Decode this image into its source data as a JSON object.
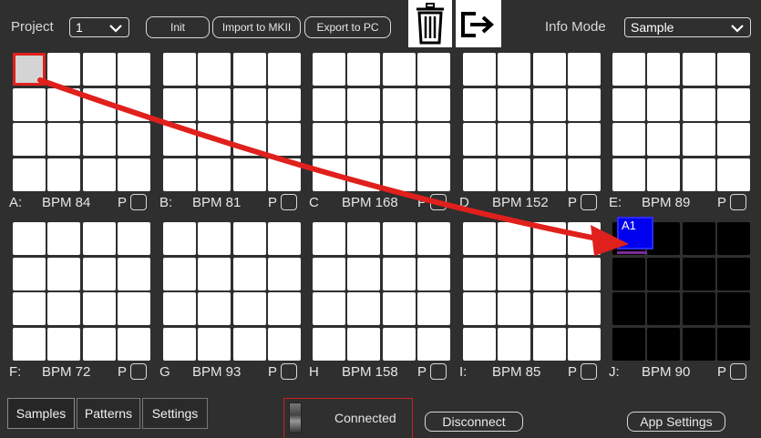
{
  "toolbar": {
    "project_label": "Project",
    "project_value": "1",
    "init_label": "Init",
    "import_label": "Import to MKII",
    "export_label": "Export to PC",
    "info_mode_label": "Info Mode",
    "info_mode_value": "Sample"
  },
  "banks": {
    "A": {
      "letter": "A:",
      "bpm": "BPM 84",
      "p": "P"
    },
    "B": {
      "letter": "B:",
      "bpm": "BPM 81",
      "p": "P"
    },
    "C": {
      "letter": "C",
      "bpm": "BPM 168",
      "p": "P"
    },
    "D": {
      "letter": "D",
      "bpm": "BPM 152",
      "p": "P"
    },
    "E": {
      "letter": "E:",
      "bpm": "BPM 89",
      "p": "P"
    },
    "F": {
      "letter": "F:",
      "bpm": "BPM 72",
      "p": "P"
    },
    "G": {
      "letter": "G",
      "bpm": "BPM 93",
      "p": "P"
    },
    "H": {
      "letter": "H",
      "bpm": "BPM 158",
      "p": "P"
    },
    "I": {
      "letter": "I:",
      "bpm": "BPM 85",
      "p": "P"
    },
    "J": {
      "letter": "J:",
      "bpm": "BPM 90",
      "p": "P"
    }
  },
  "drop_marker": {
    "label": "A1"
  },
  "tabs": {
    "samples": "Samples",
    "patterns": "Patterns",
    "settings": "Settings"
  },
  "status": {
    "connection": "Connected"
  },
  "buttons": {
    "disconnect": "Disconnect",
    "app_settings": "App Settings"
  },
  "colors": {
    "background": "#2f2f2f",
    "arrow": "#e0201c",
    "drop_target": "#0000ee",
    "pad": "#ffffff"
  }
}
